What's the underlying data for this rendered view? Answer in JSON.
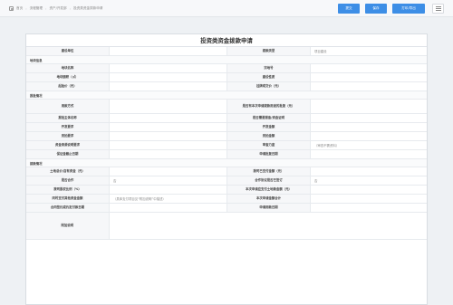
{
  "breadcrumb": [
    "首页",
    "流程管理",
    "资产/开发部",
    "投资类资金拨款申请"
  ],
  "toolbar": {
    "btn1": "提交",
    "btn2": "保存",
    "btn3": "打印/导出"
  },
  "form": {
    "title": "投资类资金拨款申请",
    "rows_top": [
      {
        "l1": "建设单位",
        "v1": "",
        "l2": "拨款类型",
        "v2": "项目建设"
      }
    ],
    "section1": "地块信息",
    "rows_s1": [
      {
        "l1": "地块名称",
        "v1": "",
        "l2": "宗地号",
        "v2": ""
      },
      {
        "l1": "地块面积（㎡）",
        "v1": "",
        "l2": "建设性质",
        "v2": ""
      },
      {
        "l1": "起始价（元）",
        "v1": "",
        "l2": "挂牌成交价（元）",
        "v2": ""
      }
    ],
    "section2": "报批情况",
    "rows_s2": [
      {
        "l1": "用款方式",
        "v1": "",
        "l2": "是否有本次申请拨款用途的批复（元）",
        "v2": "",
        "tall": true
      },
      {
        "l1": "报批主体名称",
        "v1": "",
        "l2": "是否需要报备/资金证明",
        "v2": ""
      },
      {
        "l1": "开发要求",
        "v1": "",
        "l2": "开发金额",
        "v2": ""
      },
      {
        "l1": "竞拍要求",
        "v1": "",
        "l2": "竞拍金额",
        "v2": ""
      },
      {
        "l1": "资金来源说明要求",
        "v1": "",
        "l2": "审查力度",
        "v2": "（审查不需资料）"
      },
      {
        "l1": "保证金截止日期",
        "v1": "",
        "l2": "申请批复日期",
        "v2": ""
      }
    ],
    "section3": "拨款情况",
    "rows_s3": [
      {
        "l1": "土地总价/自有资金（元）",
        "v1": "",
        "l2": "我司已支付金额（元）",
        "v2": ""
      },
      {
        "l1": "是否合作",
        "v1": "否",
        "l2": "合作协议是否已签订",
        "v2": "否"
      },
      {
        "l1": "我司股权比例（%）",
        "v1": "",
        "l2": "本次申请应支付土地款金额（元）",
        "v2": ""
      },
      {
        "l1": "同时支付其他资金金额",
        "v1": "（具体支付项目见“附加说明”中描述）",
        "l2": "本次申请金额合计",
        "v2": ""
      },
      {
        "l1": "合同签约或约定付款日期",
        "v1": "",
        "l2": "申请用款日期",
        "v2": ""
      }
    ],
    "remarks_label": "附加说明",
    "remarks_value": ""
  }
}
